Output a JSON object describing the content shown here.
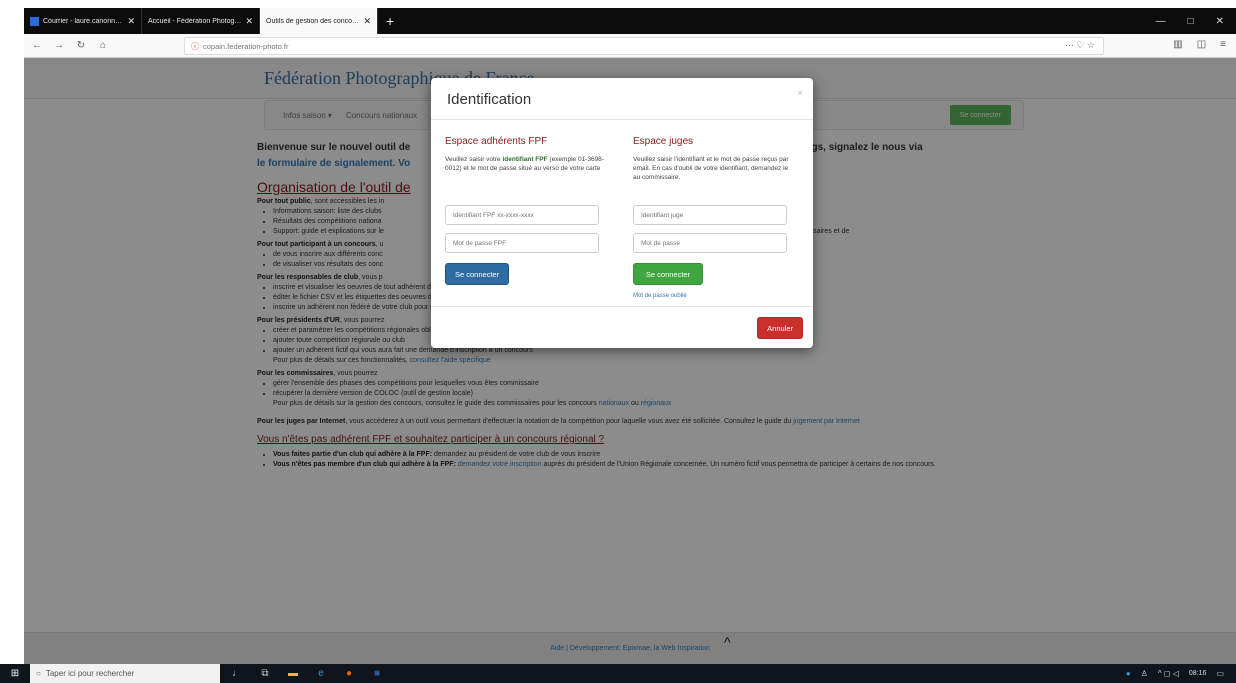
{
  "browser": {
    "tabs": [
      {
        "label": "Courrier - laure.canonne@dhr",
        "active": false
      },
      {
        "label": "Accueil - Fédération Photographiq",
        "active": false
      },
      {
        "label": "Outils de gestion des concours de l",
        "active": true
      }
    ],
    "url": "copain.federation-photo.fr"
  },
  "site": {
    "title": "Fédération Photographique de France",
    "menu": [
      "Infos saison ▾",
      "Concours nationaux"
    ],
    "login_button": "Se connecter"
  },
  "content": {
    "welcome_start": "Bienvenue sur le nouvel outil de",
    "welcome_end": "s ou bugs, signalez le nous via",
    "welcome_link": "le formulaire de signalement. Vo",
    "org_title": "Organisation de l'outil de",
    "public_heading": "Pour tout public",
    "public_intro": ", sont accessibles les in",
    "public_items": [
      "Informations saison: liste des clubs",
      "Résultats des compétitions nationa",
      "Support: guide et explications sur le"
    ],
    "public_items_tail": "des concourset les guides de gestion à destination des commissaires et de",
    "participant_heading": "Pour tout participant à un concours",
    "participant_intro": ", u",
    "participant_items": [
      "de vous inscrire aux différents conc",
      "de visualiser vos résultats des conc"
    ],
    "club_heading": "Pour les responsables de club",
    "club_intro": ", vous p",
    "club_items": [
      "inscrire et visualiser les oeuvres de tout adhérent de votre club",
      "éditer le fichier CSV et les étiquettes des oeuvres du club pour un concours",
      "inscrire un adhérent non fédéré de votre club pour qu'il participe à un concours open"
    ],
    "ur_heading": "Pour les présidents d'UR",
    "ur_intro": ", vous pourrez",
    "ur_items": [
      "créer et paramétrer les compétitions régionales obligatoires de la saison",
      "ajouter toute compétition régionale ou club",
      "ajouter un adhérent fictif qui vous aura fait une demande d'inscription à un concours"
    ],
    "ur_note": "Pour plus de détails sur ces fonctionnalités,",
    "ur_note_link": "consultez l'aide spécifique",
    "comm_heading": "Pour les commissaires",
    "comm_intro": ", vous pourrez",
    "comm_items": [
      "gérer l'ensemble des phases des compétitions pour lesquelles vous êtes commissaire",
      "récupérer la dernière version de COLOC (outil de gestion locale)"
    ],
    "comm_note": "Pour plus de détails sur la gestion des concours, consultez le guide des commissaires pour les concours",
    "comm_note_link1": "nationaux",
    "comm_note_or": "ou",
    "comm_note_link2": "régionaux",
    "judges_heading": "Pour les juges par Internet",
    "judges_text": ", vous accéderez à un outil vous permettant d'effectuer la notation de la compétition pour laquelle vous avez été sollicitée. Consultez le guide du",
    "judges_link": "jugement par Internet",
    "regional_title": "Vous n'êtes pas adhérent FPF et souhaitez participer à un concours régional ?",
    "regional_item1_bold": "Vous faites partie d'un club qui adhère à la FPF:",
    "regional_item1_text": "demandez au président de votre club de vous inscrire",
    "regional_item2_bold": "Vous n'êtes pas membre d'un club qui adhère à la FPF:",
    "regional_item2_link": "demandez votre inscription",
    "regional_item2_text": "auprès du président de l'Union Régionale concernée. Un numéro fictif vous permettra de participer à certains de nos concours."
  },
  "footer": {
    "text": "Aide  |  Développement: Epixmae, la Web Inspiration"
  },
  "modal": {
    "title": "Identification",
    "close": "×",
    "fpf": {
      "heading": "Espace adhérents FPF",
      "desc_before": "Veuillez saisir votre",
      "desc_bold": "identifiant FPF",
      "desc_after": "(exemple 01-3698-0012) et le mot de passe situé au verso de votre carte",
      "id_placeholder": "Identifiant FPF xx-xxxx-xxxx",
      "pw_placeholder": "Mot de passe FPF",
      "submit": "Se connecter"
    },
    "juges": {
      "heading": "Espace juges",
      "desc": "Veuillez saisir l'identifiant et le mot de passe reçus par email. En cas d'oubli de votre identifiant, demandez le au commissaire.",
      "id_placeholder": "Identifiant juge",
      "pw_placeholder": "Mot de passe",
      "submit": "Se connecter",
      "forgot": "Mot de passe oublié"
    },
    "cancel": "Annuler"
  },
  "taskbar": {
    "search_placeholder": "Taper ici pour rechercher",
    "time": "08:16"
  }
}
